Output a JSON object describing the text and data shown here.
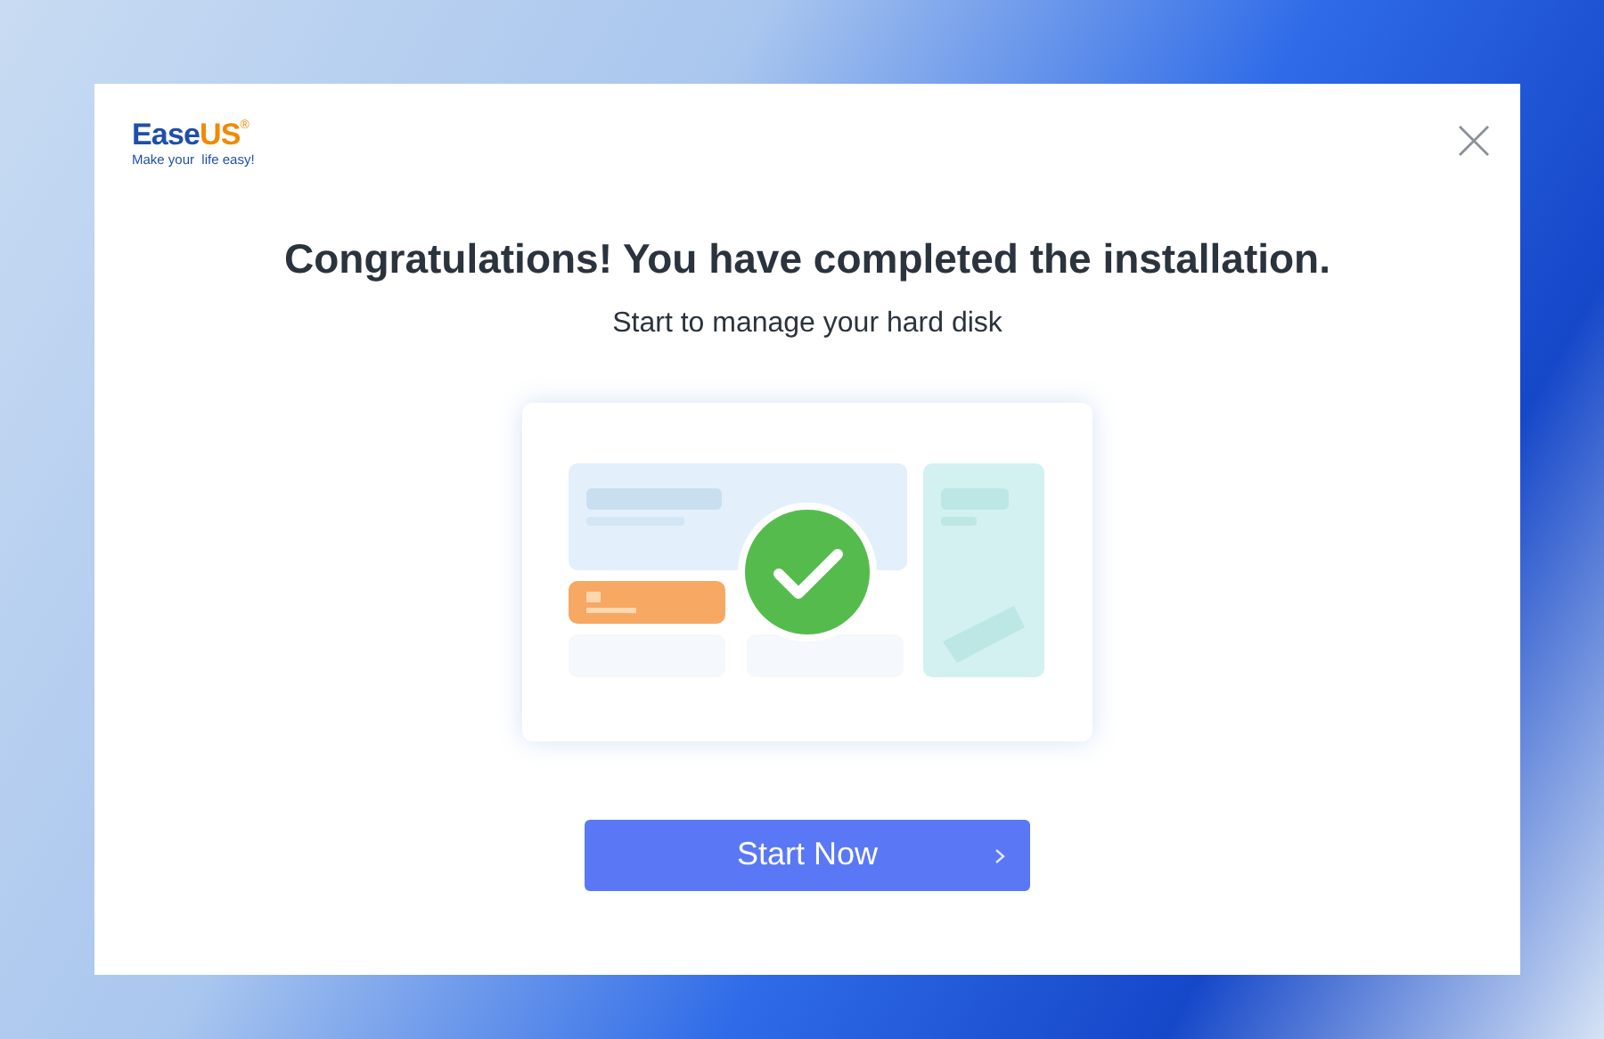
{
  "logo": {
    "brand_primary": "Ease",
    "brand_accent": "US",
    "registered_mark": "®",
    "tagline": "Make your  life easy!"
  },
  "title": "Congratulations! You have completed the installation.",
  "subtitle": "Start to manage your hard disk",
  "primary_button": {
    "label": "Start Now"
  }
}
